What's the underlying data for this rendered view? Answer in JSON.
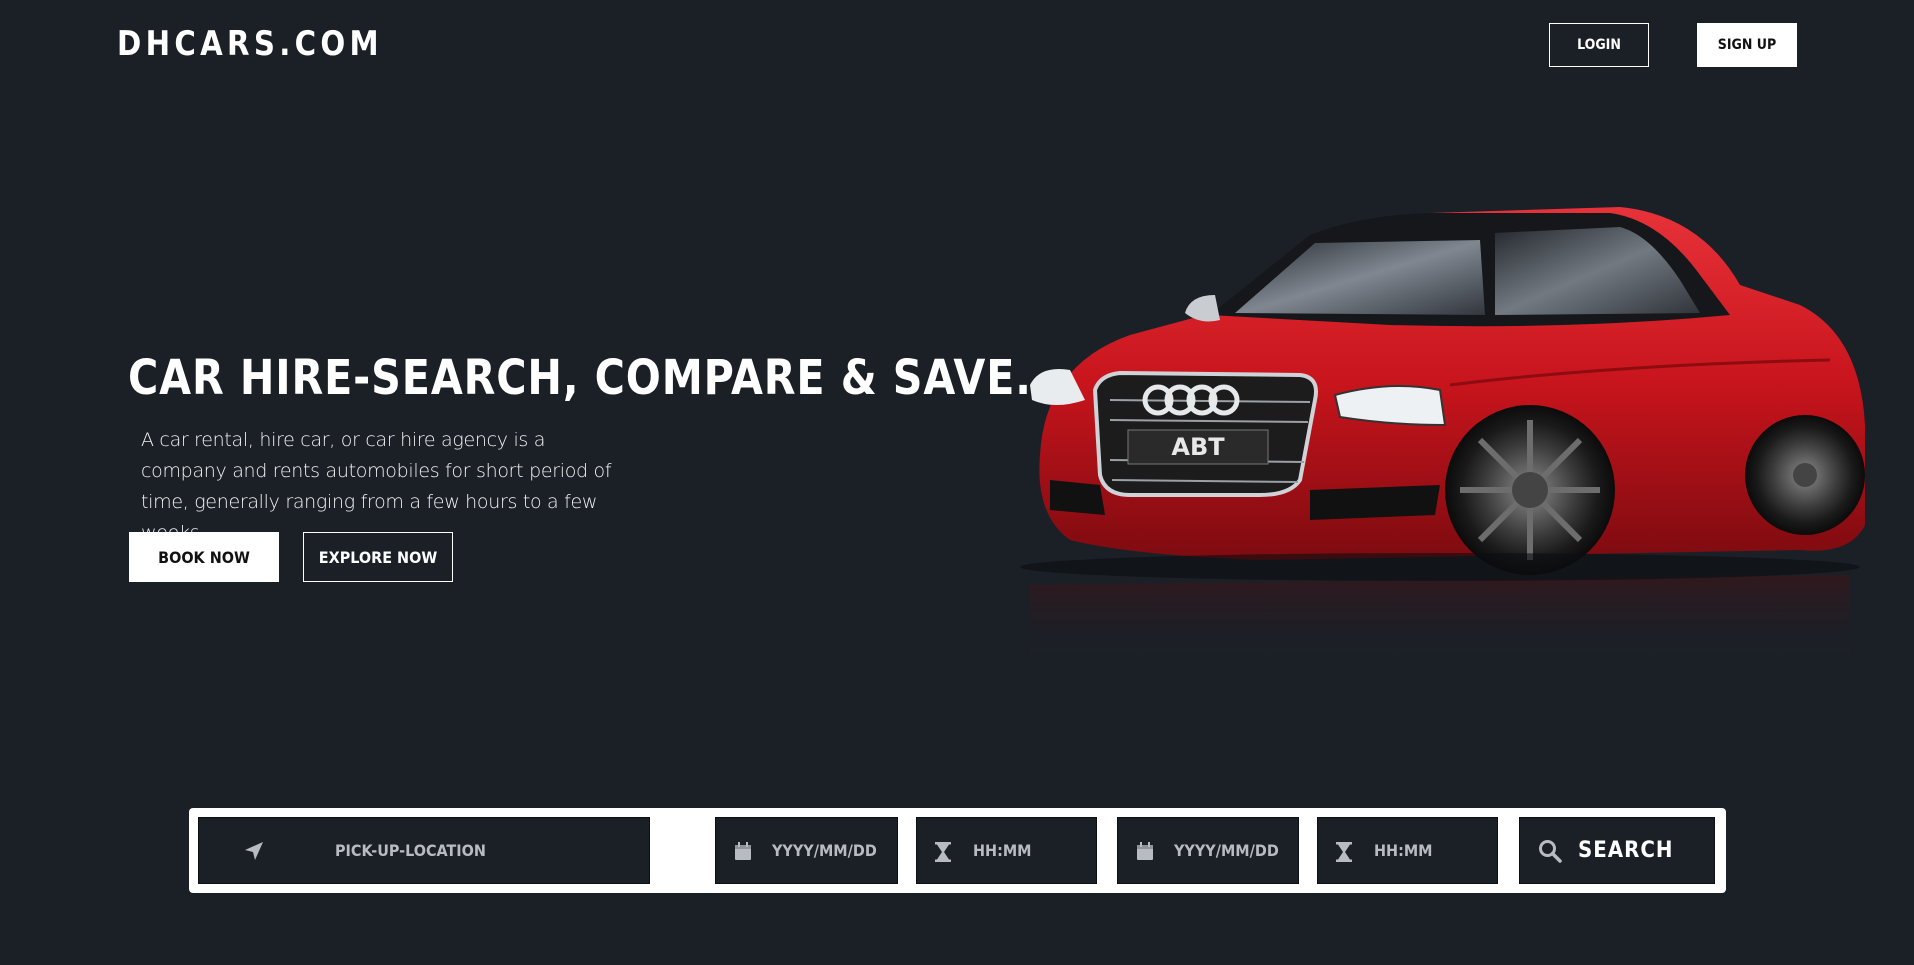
{
  "header": {
    "logo": "DHCARS.COM",
    "login_label": "LOGIN",
    "signup_label": "SIGN UP"
  },
  "hero": {
    "title": "CAR HIRE-SEARCH, COMPARE & SAVE.",
    "description": "A car rental, hire car, or car hire agency is a company and rents automobiles for short period of time, generally ranging from a few hours to a few weeks",
    "book_label": "BOOK NOW",
    "explore_label": "EXPLORE NOW"
  },
  "search": {
    "pickup_placeholder": "PICK-UP-LOCATION",
    "pickup_date_placeholder": "YYYY/MM/DD",
    "pickup_time_placeholder": "HH:MM",
    "return_date_placeholder": "YYYY/MM/DD",
    "return_time_placeholder": "HH:MM",
    "search_label": "SEARCH",
    "icons": [
      "location-arrow-icon",
      "calendar-icon",
      "hourglass-icon",
      "calendar-icon",
      "hourglass-icon",
      "search-icon"
    ]
  },
  "colors": {
    "background": "#1b2027",
    "car_red": "#c8141c",
    "white": "#ffffff"
  }
}
